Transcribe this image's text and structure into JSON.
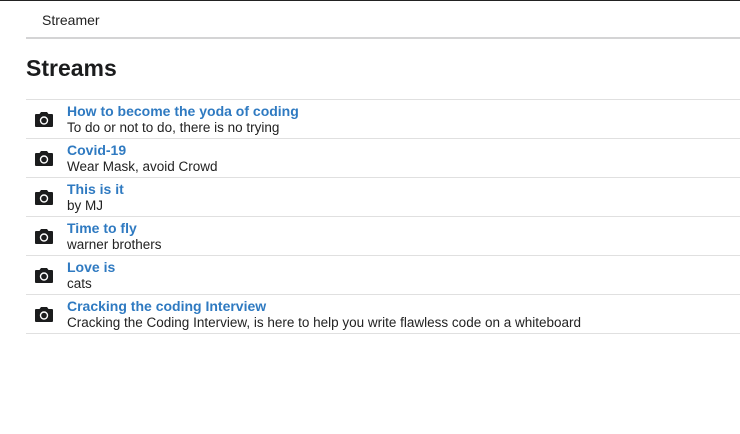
{
  "nav": {
    "brand": "Streamer"
  },
  "page": {
    "title": "Streams"
  },
  "streams": [
    {
      "icon": "camera-icon",
      "title": "How to become the yoda of coding",
      "description": "To do or not to do, there is no trying"
    },
    {
      "icon": "camera-icon",
      "title": "Covid-19",
      "description": "Wear Mask, avoid Crowd"
    },
    {
      "icon": "camera-icon",
      "title": "This is it",
      "description": "by MJ"
    },
    {
      "icon": "camera-icon",
      "title": "Time to fly",
      "description": "warner brothers"
    },
    {
      "icon": "camera-icon",
      "title": "Love is",
      "description": "cats"
    },
    {
      "icon": "camera-icon",
      "title": "Cracking the coding Interview",
      "description": "Cracking the Coding Interview, is here to help you write flawless code on a whiteboard"
    }
  ],
  "colors": {
    "link": "#2f7ac1",
    "text": "#222222",
    "divider": "#e0e0e0"
  }
}
